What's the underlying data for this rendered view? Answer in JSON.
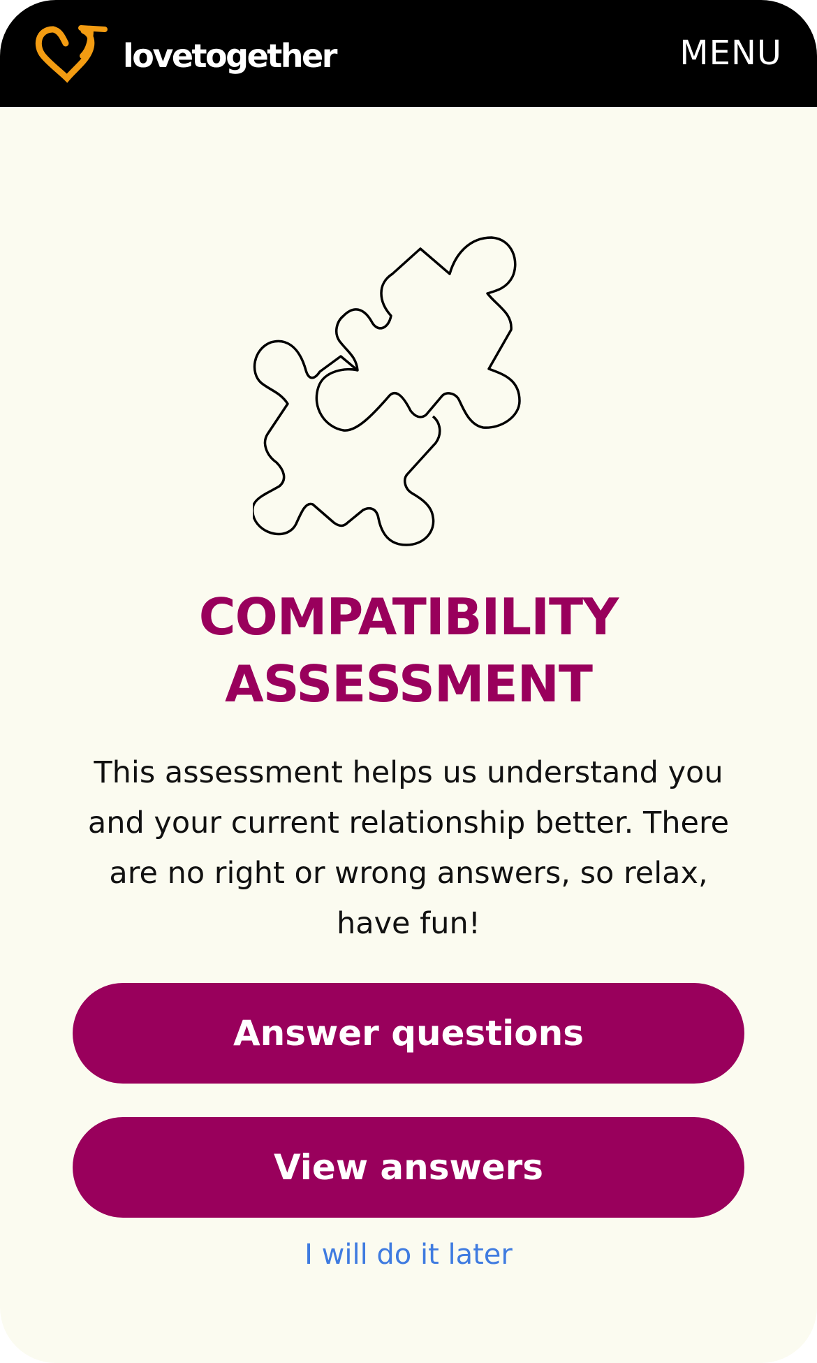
{
  "header": {
    "brand_name": "lovetogether",
    "menu_label": "MENU",
    "logo_icon": "heart-arrow-icon",
    "logo_color": "#f39c12"
  },
  "main": {
    "illustration_icon": "puzzle-pieces-icon",
    "title_line1": "COMPATIBILITY",
    "title_line2": "ASSESSMENT",
    "description": "This assessment helps us understand you and your current relationship better. There are no right or wrong answers, so relax, have fun!",
    "primary_button_label": "Answer questions",
    "secondary_button_label": "View answers",
    "later_link_label": "I will do it later"
  },
  "colors": {
    "accent": "#99005c",
    "background": "#fbfbf0",
    "header_background": "#000000",
    "link": "#3f7be0"
  }
}
